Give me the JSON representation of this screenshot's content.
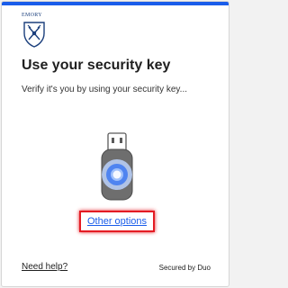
{
  "brand": {
    "logo_text": "EMORY",
    "accent_color": "#1a5dea"
  },
  "page": {
    "title": "Use your security key",
    "subtitle": "Verify it's you by using your security key..."
  },
  "actions": {
    "other_options_label": "Other options",
    "need_help_label": "Need help?"
  },
  "footer": {
    "secured_by": "Secured by Duo"
  },
  "icons": {
    "logo": "emory-shield-icon",
    "device": "security-key-icon"
  }
}
